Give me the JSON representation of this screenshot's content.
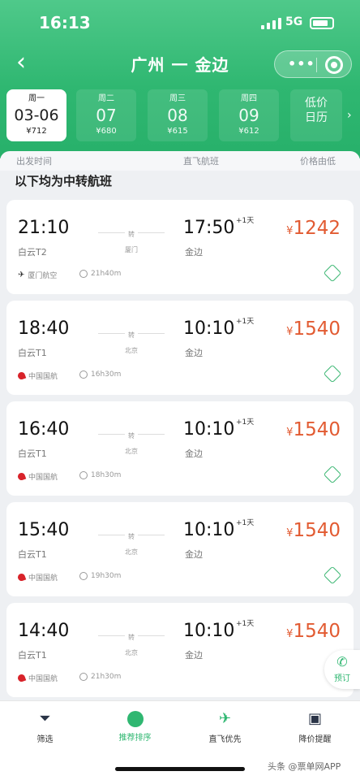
{
  "status": {
    "time": "16:13",
    "network": "5G"
  },
  "nav": {
    "back_icon": "chevron-left-icon",
    "title": "广州 一 金边",
    "more_icon": "ellipsis-icon",
    "close_icon": "target-circle-icon"
  },
  "dates": [
    {
      "weekday": "周一",
      "date": "03-06",
      "price": "¥712",
      "selected": true
    },
    {
      "weekday": "周二",
      "date": "07",
      "price": "¥680",
      "selected": false
    },
    {
      "weekday": "周三",
      "date": "08",
      "price": "¥615",
      "selected": false
    },
    {
      "weekday": "周四",
      "date": "09",
      "price": "¥612",
      "selected": false
    }
  ],
  "calendar": {
    "line1": "低价",
    "line2": "日历"
  },
  "sort": {
    "col1": "出发时间",
    "col2": "直飞航班",
    "col3": "价格由低"
  },
  "section_title": "以下均为中转航班",
  "flights": [
    {
      "dep_time": "21:10",
      "dep_airport": "白云T2",
      "stop": "转",
      "stop_city": "厦门",
      "arr_time": "17:50",
      "next_day": "+1天",
      "arr_airport": "金边",
      "price": "1242",
      "currency": "¥",
      "airline": "厦门航空",
      "duration": "21h40m"
    },
    {
      "dep_time": "18:40",
      "dep_airport": "白云T1",
      "stop": "转",
      "stop_city": "北京",
      "arr_time": "10:10",
      "next_day": "+1天",
      "arr_airport": "金边",
      "price": "1540",
      "currency": "¥",
      "airline": "中国国航",
      "duration": "16h30m"
    },
    {
      "dep_time": "16:40",
      "dep_airport": "白云T1",
      "stop": "转",
      "stop_city": "北京",
      "arr_time": "10:10",
      "next_day": "+1天",
      "arr_airport": "金边",
      "price": "1540",
      "currency": "¥",
      "airline": "中国国航",
      "duration": "18h30m"
    },
    {
      "dep_time": "15:40",
      "dep_airport": "白云T1",
      "stop": "转",
      "stop_city": "北京",
      "arr_time": "10:10",
      "next_day": "+1天",
      "arr_airport": "金边",
      "price": "1540",
      "currency": "¥",
      "airline": "中国国航",
      "duration": "19h30m"
    },
    {
      "dep_time": "14:40",
      "dep_airport": "白云T1",
      "stop": "转",
      "stop_city": "北京",
      "arr_time": "10:10",
      "next_day": "+1天",
      "arr_airport": "金边",
      "price": "1540",
      "currency": "¥",
      "airline": "中国国航",
      "duration": "21h30m"
    }
  ],
  "service": {
    "label": "预订"
  },
  "tabs": [
    {
      "icon": "filter-icon",
      "label": "筛选"
    },
    {
      "icon": "recommend-icon",
      "label": "推荐排序"
    },
    {
      "icon": "plane-icon",
      "label": "直飞优先"
    },
    {
      "icon": "notice-icon",
      "label": "降价提醒"
    }
  ],
  "watermark": "头条 @票单网APP"
}
